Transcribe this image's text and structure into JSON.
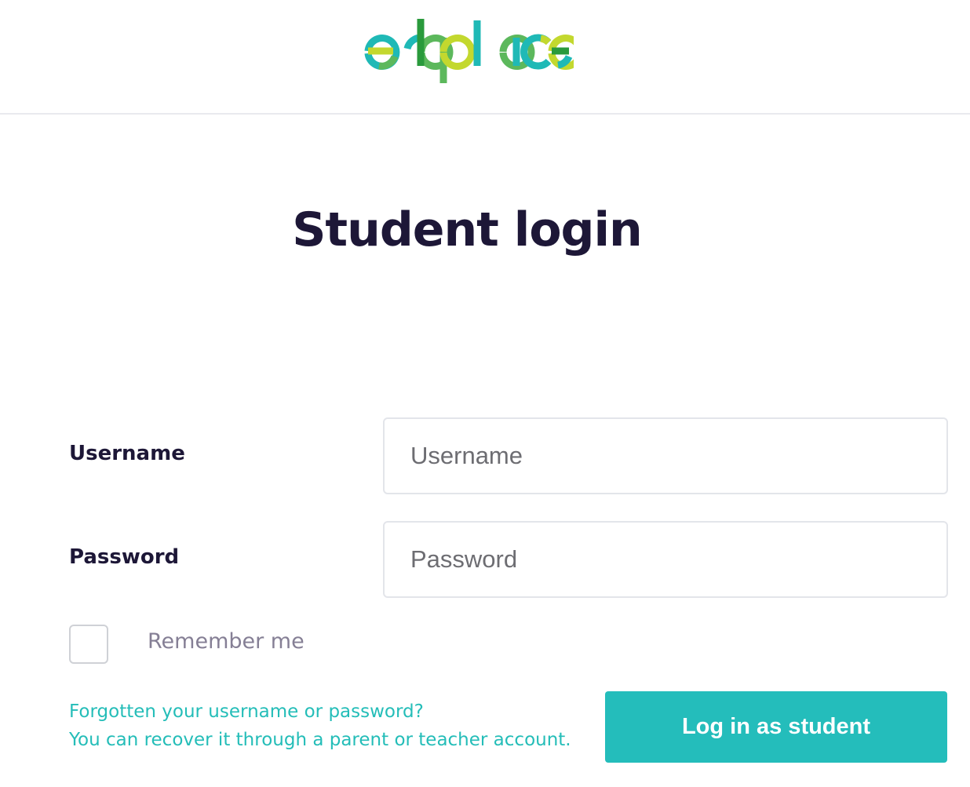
{
  "brand": {
    "logo_text": "ed place",
    "colors": {
      "teal": "#1fb9b6",
      "green": "#5cb85c",
      "lime": "#c3d82e",
      "dark_green": "#2a9a3c"
    }
  },
  "page": {
    "title": "Student login"
  },
  "form": {
    "username_label": "Username",
    "username_placeholder": "Username",
    "password_label": "Password",
    "password_placeholder": "Password",
    "remember_label": "Remember me",
    "recover_line_1": "Forgotten your username or password?",
    "recover_line_2": "You can recover it through a parent or teacher account.",
    "submit_label": "Log in as student"
  },
  "colors": {
    "heading": "#1d1737",
    "accent": "#24bdbb",
    "muted": "#857f95",
    "border": "#e3e5ea"
  }
}
